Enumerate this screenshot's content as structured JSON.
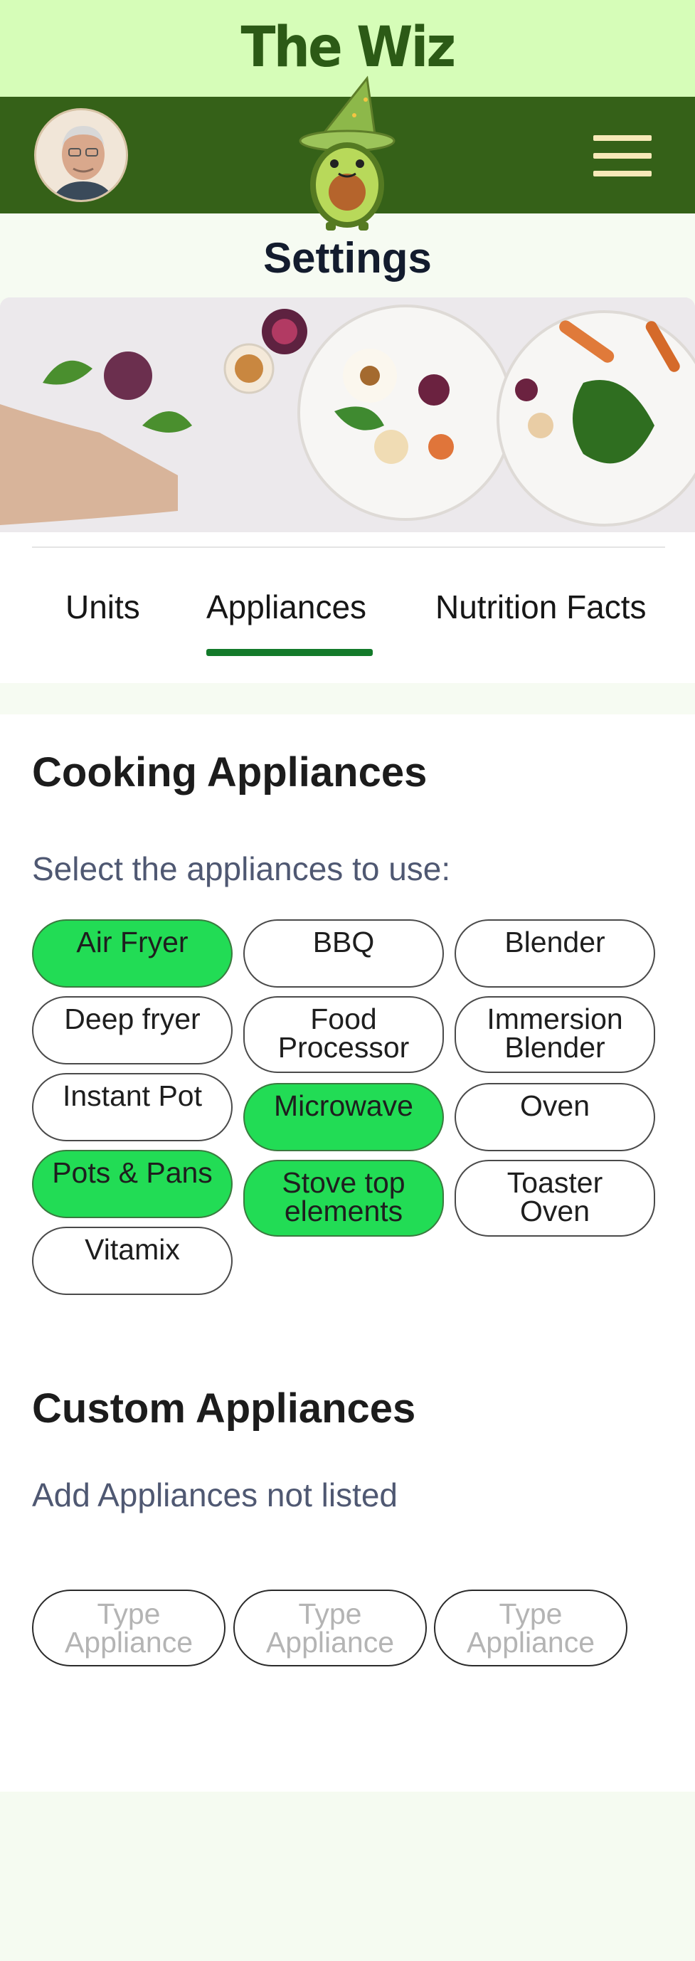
{
  "header": {
    "title": "The Wiz"
  },
  "page": {
    "title": "Settings"
  },
  "tabs": [
    {
      "label": "Units",
      "active": false
    },
    {
      "label": "Appliances",
      "active": true
    },
    {
      "label": "Nutrition Facts",
      "active": false
    }
  ],
  "cooking": {
    "heading": "Cooking Appliances",
    "subheading": "Select the appliances to use:",
    "appliances": [
      {
        "label": "Air Fryer",
        "selected": true
      },
      {
        "label": "BBQ",
        "selected": false
      },
      {
        "label": "Blender",
        "selected": false
      },
      {
        "label": "Deep fryer",
        "selected": false
      },
      {
        "label": "Food Processor",
        "selected": false
      },
      {
        "label": "Immersion Blender",
        "selected": false
      },
      {
        "label": "Instant Pot",
        "selected": false
      },
      {
        "label": "Microwave",
        "selected": true
      },
      {
        "label": "Oven",
        "selected": false
      },
      {
        "label": "Pots & Pans",
        "selected": true
      },
      {
        "label": "Stove top elements",
        "selected": true
      },
      {
        "label": "Toaster Oven",
        "selected": false
      },
      {
        "label": "Vitamix",
        "selected": false
      }
    ]
  },
  "custom": {
    "heading": "Custom Appliances",
    "subheading": "Add Appliances not listed",
    "inputs": [
      {
        "placeholder": "Type Appliance"
      },
      {
        "placeholder": "Type Appliance"
      },
      {
        "placeholder": "Type Appliance"
      }
    ]
  },
  "colors": {
    "top_bar": "#d6fdb8",
    "nav_bar": "#356118",
    "selected_chip": "#22dc55",
    "tab_indicator": "#137a2a"
  },
  "icons": {
    "menu": "hamburger-menu-icon",
    "mascot": "avocado-wizard-mascot"
  }
}
